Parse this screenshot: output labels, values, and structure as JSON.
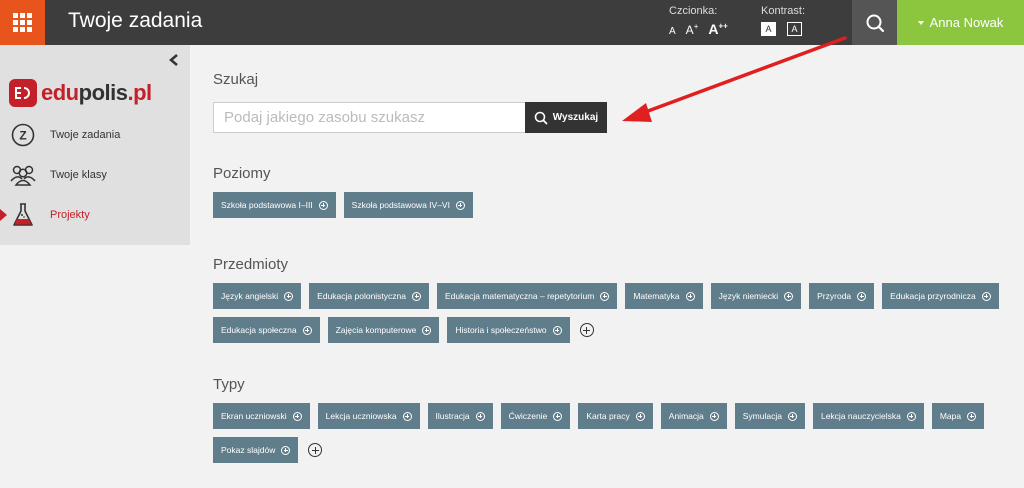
{
  "header": {
    "title": "Twoje zadania",
    "font_label": "Czcionka:",
    "font_sizes": [
      "A",
      "A",
      "+",
      "A",
      "++"
    ],
    "contrast_label": "Kontrast:",
    "contrast_options": [
      "A",
      "A"
    ],
    "user_name": "Anna Nowak",
    "colors": {
      "bar": "#3d3d3d",
      "menu": "#e8551c",
      "user": "#8cc63f"
    }
  },
  "sidebar": {
    "logo": {
      "part1": "edu",
      "part2": "polis",
      "part3": ".pl"
    },
    "items": [
      {
        "label": "Twoje zadania",
        "icon": "z-circle-icon",
        "active": false
      },
      {
        "label": "Twoje klasy",
        "icon": "people-icon",
        "active": false
      },
      {
        "label": "Projekty",
        "icon": "flask-icon",
        "active": true
      }
    ]
  },
  "search": {
    "title": "Szukaj",
    "placeholder": "Podaj jakiego zasobu szukasz",
    "button_label": "Wyszukaj"
  },
  "sections": {
    "levels": {
      "title": "Poziomy",
      "tags": [
        "Szkoła podstawowa I–III",
        "Szkoła podstawowa IV–VI"
      ]
    },
    "subjects": {
      "title": "Przedmioty",
      "tags": [
        "Język angielski",
        "Edukacja polonistyczna",
        "Edukacja matematyczna – repetytorium",
        "Matematyka",
        "Język niemiecki",
        "Przyroda",
        "Edukacja przyrodnicza",
        "Edukacja społeczna",
        "Zajęcia komputerowe",
        "Historia i społeczeństwo"
      ]
    },
    "types": {
      "title": "Typy",
      "tags": [
        "Ekran uczniowski",
        "Lekcja uczniowska",
        "Ilustracja",
        "Ćwiczenie",
        "Karta pracy",
        "Animacja",
        "Symulacja",
        "Lekcja nauczycielska",
        "Mapa",
        "Pokaz slajdów"
      ]
    }
  },
  "tag_color": "#607d8b",
  "annotation_color": "#e02020"
}
